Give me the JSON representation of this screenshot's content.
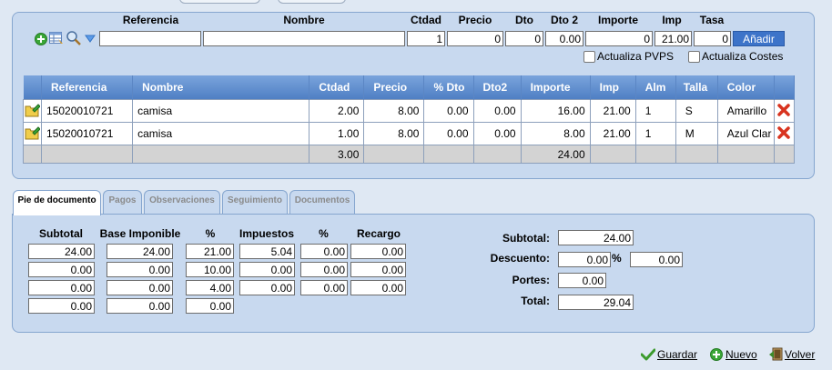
{
  "entry": {
    "headers": {
      "referencia": "Referencia",
      "nombre": "Nombre",
      "ctdad": "Ctdad",
      "precio": "Precio",
      "dto": "Dto",
      "dto2": "Dto 2",
      "importe": "Importe",
      "imp": "Imp",
      "tasa": "Tasa"
    },
    "values": {
      "referencia": "",
      "nombre": "",
      "ctdad": "1",
      "precio": "0",
      "dto": "0",
      "dto2": "0.00",
      "importe": "0",
      "imp": "21.00",
      "tasa": "0"
    },
    "add_button": "Añadir",
    "check_pvps": "Actualiza PVPS",
    "check_costes": "Actualiza Costes"
  },
  "lines": {
    "columns": [
      "Referencia",
      "Nombre",
      "Ctdad",
      "Precio",
      "% Dto",
      "Dto2",
      "Importe",
      "Imp",
      "Alm",
      "Talla",
      "Color"
    ],
    "rows": [
      {
        "referencia": "15020010721",
        "nombre": "camisa",
        "ctdad": "2.00",
        "precio": "8.00",
        "dto": "0.00",
        "dto2": "0.00",
        "importe": "16.00",
        "imp": "21.00",
        "alm": "1",
        "talla": "S",
        "color": "Amarillo"
      },
      {
        "referencia": "15020010721",
        "nombre": "camisa",
        "ctdad": "1.00",
        "precio": "8.00",
        "dto": "0.00",
        "dto2": "0.00",
        "importe": "8.00",
        "imp": "21.00",
        "alm": "1",
        "talla": "M",
        "color": "Azul Clar"
      }
    ],
    "totals": {
      "ctdad": "3.00",
      "importe": "24.00"
    }
  },
  "tabs": [
    "Pie de documento",
    "Pagos",
    "Observaciones",
    "Seguimiento",
    "Documentos"
  ],
  "footer": {
    "headers": {
      "subtotal": "Subtotal",
      "base": "Base Imponible",
      "pct": "%",
      "impuestos": "Impuestos",
      "pct2": "%",
      "recargo": "Recargo"
    },
    "rows": [
      {
        "subtotal": "24.00",
        "base": "24.00",
        "pct": "21.00",
        "impuestos": "5.04",
        "pct2": "0.00",
        "recargo": "0.00"
      },
      {
        "subtotal": "0.00",
        "base": "0.00",
        "pct": "10.00",
        "impuestos": "0.00",
        "pct2": "0.00",
        "recargo": "0.00"
      },
      {
        "subtotal": "0.00",
        "base": "0.00",
        "pct": "4.00",
        "impuestos": "0.00",
        "pct2": "0.00",
        "recargo": "0.00"
      },
      {
        "subtotal": "0.00",
        "base": "0.00",
        "pct": "0.00"
      }
    ],
    "summary": {
      "subtotal_label": "Subtotal:",
      "subtotal": "24.00",
      "descuento_label": "Descuento:",
      "descuento_pct": "0.00",
      "pct_sign": "%",
      "descuento": "0.00",
      "portes_label": "Portes:",
      "portes": "0.00",
      "total_label": "Total:",
      "total": "29.04"
    }
  },
  "actions": {
    "guardar": "Guardar",
    "nuevo": "Nuevo",
    "volver": "Volver"
  },
  "icons": {
    "add": "plus-circle-icon",
    "grid": "table-icon",
    "search": "magnifier-icon",
    "filter": "triangle-down-icon",
    "edit": "folder-edit-icon",
    "delete": "red-x-icon",
    "save": "check-icon",
    "back": "back-icon"
  }
}
